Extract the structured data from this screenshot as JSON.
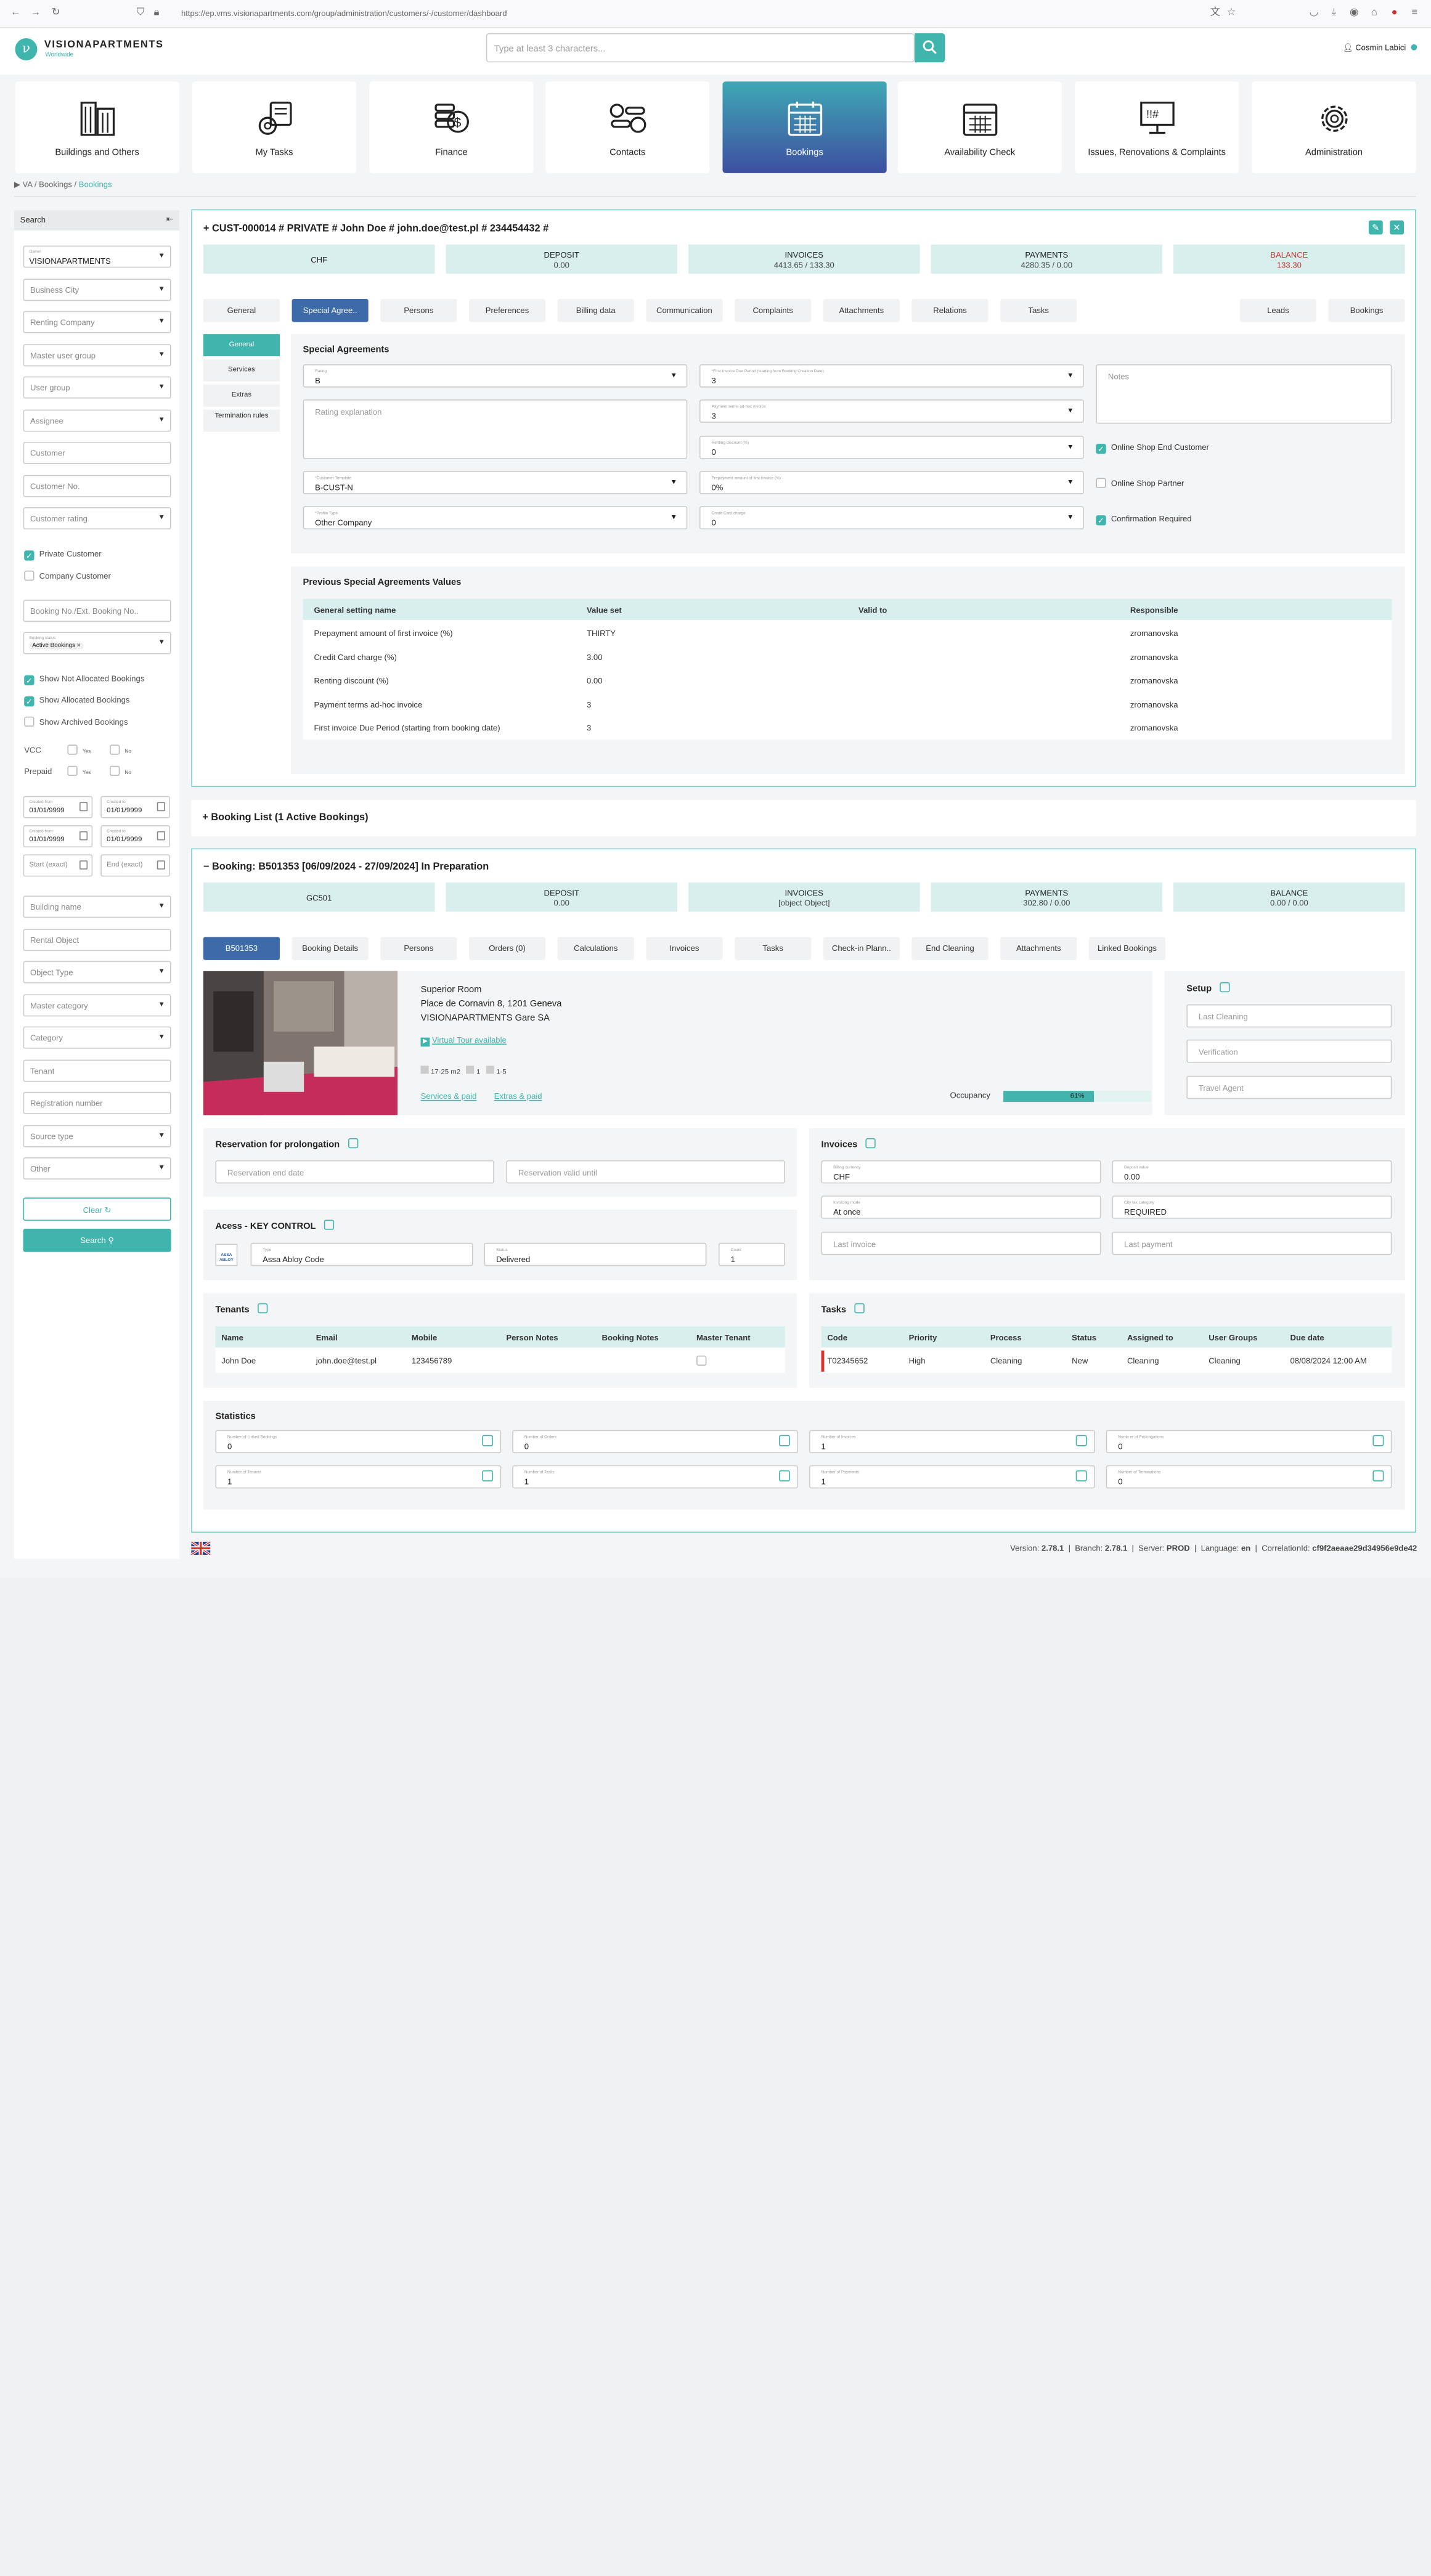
{
  "browser": {
    "url": "https://ep.vms.visionapartments.com/group/administration/customers/-/customer/dashboard"
  },
  "brand": {
    "name": "VISIONAPARTMENTS",
    "sub": "Worldwide",
    "accent": "#3fb5ad"
  },
  "header": {
    "search_placeholder": "Type at least 3 characters...",
    "user": "Cosmin Labici"
  },
  "tiles": [
    {
      "label": "Buildings and Others",
      "icon": "buildings-icon"
    },
    {
      "label": "My Tasks",
      "icon": "tasks-icon"
    },
    {
      "label": "Finance",
      "icon": "finance-icon"
    },
    {
      "label": "Contacts",
      "icon": "contacts-icon"
    },
    {
      "label": "Bookings",
      "icon": "calendar-icon"
    },
    {
      "label": "Availability Check",
      "icon": "availability-calendar-icon"
    },
    {
      "label": "Issues, Renovations & Complaints",
      "icon": "issues-icon"
    },
    {
      "label": "Administration",
      "icon": "gear-icon"
    }
  ],
  "breadcrumb": {
    "path": "VA / Bookings / ",
    "current": "Bookings"
  },
  "sidebar": {
    "title": "Search",
    "owner_label": "Owner",
    "owner": "VISIONAPARTMENTS",
    "business_city": "Business City",
    "renting_company": "Renting Company",
    "master_user_group": "Master user group",
    "user_group": "User group",
    "assignee": "Assignee",
    "customer": "Customer",
    "customer_no": "Customer No.",
    "customer_rating": "Customer rating",
    "private_customer": "Private Customer",
    "company_customer": "Company Customer",
    "booking_no": "Booking No./Ext. Booking No..",
    "booking_status_label": "Booking status",
    "booking_status_chip": "Active Bookings",
    "show_not_allocated": "Show Not Allocated Bookings",
    "show_allocated": "Show Allocated Bookings",
    "show_archived": "Show Archived Bookings",
    "vcc": "VCC",
    "prepaid": "Prepaid",
    "yes": "Yes",
    "no": "No",
    "created_from": "Created from",
    "created_to": "Created to",
    "date_val": "01/01/9999",
    "start_exact": "Start (exact)",
    "end_exact": "End (exact)",
    "building_name": "Building name",
    "rental_object": "Rental Object",
    "object_type": "Object Type",
    "master_category": "Master category",
    "category": "Category",
    "tenant": "Tenant",
    "registration_number": "Registration number",
    "source_type": "Source type",
    "other": "Other",
    "clear": "Clear",
    "search": "Search"
  },
  "customer": {
    "title": "CUST-000014 # PRIVATE # John Doe # john.doe@test.pl # 234454432 #",
    "currency": "CHF",
    "deposit_label": "DEPOSIT",
    "deposit": "0.00",
    "invoices_label": "INVOICES",
    "invoices": "4413.65 / 133.30",
    "payments_label": "PAYMENTS",
    "payments": "4280.35 / 0.00",
    "balance_label": "BALANCE",
    "balance": "133.30",
    "tabs": [
      "General",
      "Special Agree..",
      "Persons",
      "Preferences",
      "Billing data",
      "Communication",
      "Complaints",
      "Attachments",
      "Relations",
      "Tasks"
    ],
    "tabs_right": [
      "Leads",
      "Bookings"
    ],
    "subnav": [
      "General",
      "Services",
      "Extras",
      "Termination rules"
    ],
    "sa": {
      "title": "Special Agreements",
      "rating_label": "Rating",
      "rating": "B",
      "rating_expl": "Rating explanation",
      "template_label": "*Customer Template",
      "template": "B-CUST-N",
      "profile_label": "*Profile Type",
      "profile": "Other Company",
      "fid_label": "*First Invoice Due Period (starting from Booking Creation Date)",
      "fid": "3",
      "ptah_label": "Payment terms ad-hoc invoice",
      "ptah": "3",
      "rd_label": "Renting discount (%)",
      "rd": "0",
      "pa_label": "Prepayment amount of first invoice (%)",
      "pa": "0%",
      "cc_label": "Credit Card charge",
      "cc": "0",
      "notes": "Notes",
      "online_end": "Online Shop End Customer",
      "online_partner": "Online Shop Partner",
      "confirmation": "Confirmation Required"
    },
    "prev": {
      "title": "Previous Special Agreements Values",
      "headers": [
        "General setting name",
        "Value set",
        "Valid to",
        "Responsible"
      ],
      "rows": [
        [
          "Prepayment amount of first invoice (%)",
          "THIRTY",
          "",
          "zromanovska"
        ],
        [
          "Credit Card charge (%)",
          "3.00",
          "",
          "zromanovska"
        ],
        [
          "Renting discount (%)",
          "0.00",
          "",
          "zromanovska"
        ],
        [
          "Payment terms ad-hoc invoice",
          "3",
          "",
          "zromanovska"
        ],
        [
          "First invoice Due Period (starting from booking date)",
          "3",
          "",
          "zromanovska"
        ]
      ]
    }
  },
  "booking_list": {
    "title": "Booking List (1 Active Bookings)"
  },
  "booking": {
    "title": "Booking: B501353 [06/09/2024 - 27/09/2024] In Preparation",
    "code": "GC501",
    "deposit_label": "DEPOSIT",
    "deposit": "0.00",
    "invoices_label": "INVOICES",
    "invoices": {
      "title": "Invoices",
      "billing_label": "Billing currency",
      "billing": "CHF",
      "deposit_label": "Deposit value",
      "deposit": "0.00",
      "mode_label": "Invoicing mode",
      "mode": "At once",
      "tax_label": "City tax category",
      "tax": "REQUIRED",
      "last_invoice": "Last invoice",
      "last_payment": "Last payment"
    },
    "payments_label": "PAYMENTS",
    "payments": "302.80 / 0.00",
    "balance_label": "BALANCE",
    "balance": "0.00 / 0.00",
    "tabs": [
      "B501353",
      "Booking Details",
      "Persons",
      "Orders (0)",
      "Calculations",
      "Invoices",
      "Tasks",
      "Check-in Plann..",
      "End Cleaning",
      "Attachments",
      "Linked Bookings"
    ],
    "room": {
      "name": "Superior Room",
      "address": "Place de Cornavin 8, 1201 Geneva",
      "building": "VISIONAPARTMENTS Gare SA",
      "tour": "Virtual Tour available",
      "size": "17-25 m2",
      "beds": "1",
      "persons": "1-5",
      "services": "Services & paid",
      "extras": "Extras & paid",
      "occupancy_label": "Occupancy",
      "occupancy": "61%",
      "occupancy_value": 0.61
    },
    "setup": {
      "title": "Setup",
      "last_cleaning": "Last Cleaning",
      "verification": "Verification",
      "travel_agent": "Travel Agent"
    },
    "reservation": {
      "title": "Reservation for prolongation",
      "end": "Reservation end date",
      "valid": "Reservation valid until"
    },
    "access": {
      "title": "Acess - KEY CONTROL",
      "logo": "ASSA ABLOY",
      "type_label": "Type",
      "type": "Assa Abloy Code",
      "status_label": "Status",
      "status": "Delivered",
      "count_label": "Count",
      "count": "1"
    },
    "tenants": {
      "title": "Tenants",
      "headers": [
        "Name",
        "Email",
        "Mobile",
        "Person Notes",
        "Booking Notes",
        "Master Tenant"
      ],
      "row": [
        "John Doe",
        "john.doe@test.pl",
        "123456789",
        "",
        ""
      ]
    },
    "tasks": {
      "title": "Tasks",
      "headers": [
        "Code",
        "Priority",
        "Process",
        "Status",
        "Assigned to",
        "User Groups",
        "Due date"
      ],
      "row": [
        "T02345652",
        "High",
        "Cleaning",
        "New",
        "Cleaning",
        "Cleaning",
        "08/08/2024 12:00 AM"
      ]
    },
    "stats": {
      "title": "Statistics",
      "items": [
        {
          "label": "Number of Linked Bookings",
          "value": "0"
        },
        {
          "label": "Number of Orders",
          "value": "0"
        },
        {
          "label": "Number of Invoices",
          "value": "1"
        },
        {
          "label": "Numb er of Prolongations",
          "value": "0"
        },
        {
          "label": "Number of Tenants",
          "value": "1"
        },
        {
          "label": "Number of Tasks",
          "value": "1"
        },
        {
          "label": "Number of Payments",
          "value": "1"
        },
        {
          "label": "Number of Terminations",
          "value": "0"
        }
      ]
    }
  },
  "footer": {
    "version_label": "Version:",
    "version": "2.78.1",
    "branch_label": "Branch:",
    "branch": "2.78.1",
    "server_label": "Server:",
    "server": "PROD",
    "language_label": "Language:",
    "language": "en",
    "corr_label": "CorrelationId:",
    "corr": "cf9f2aeaae29d34956e9de42"
  }
}
